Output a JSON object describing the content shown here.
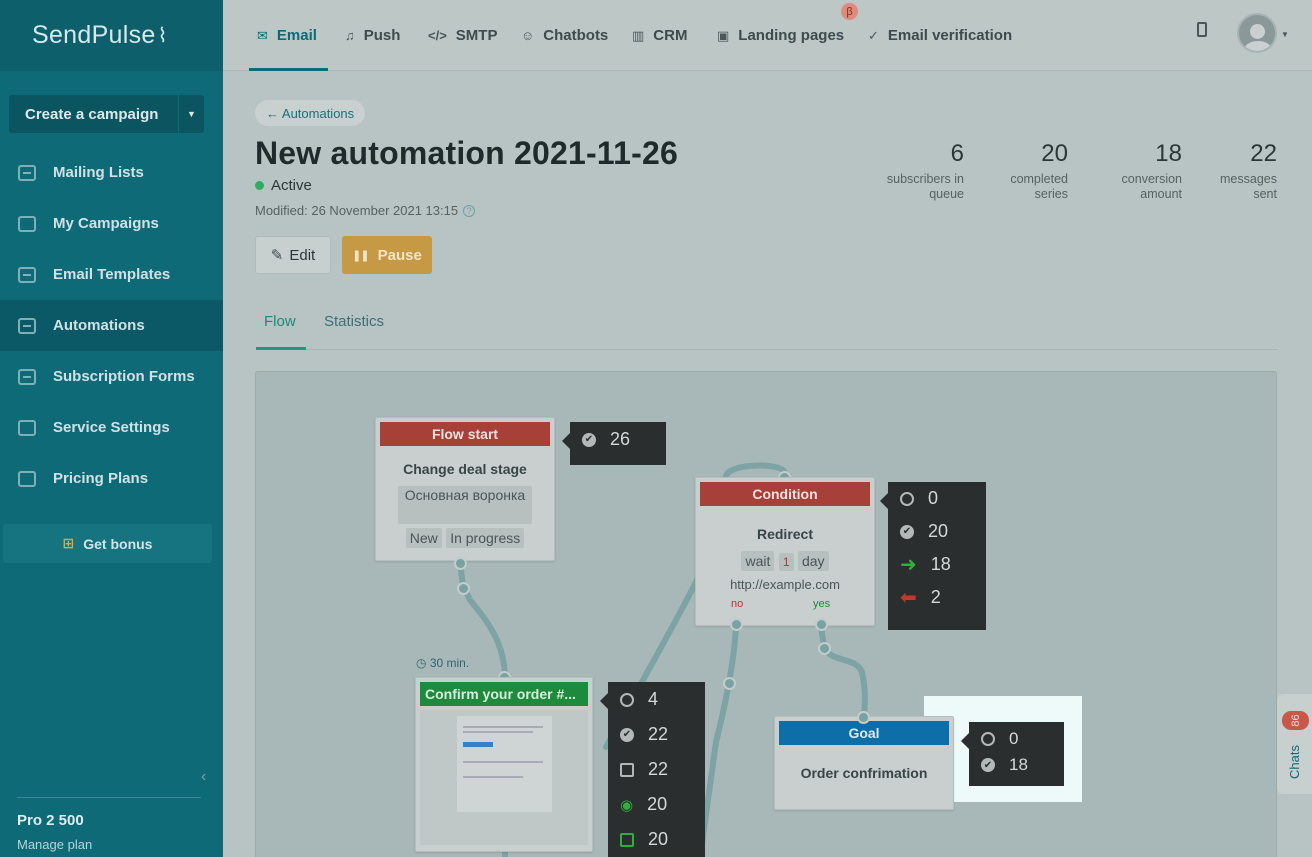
{
  "brand": {
    "name": "SendPulse",
    "pulse": "‸→"
  },
  "sidebar": {
    "create_label": "Create a campaign",
    "items": [
      {
        "label": "Mailing Lists"
      },
      {
        "label": "My Campaigns"
      },
      {
        "label": "Email Templates"
      },
      {
        "label": "Automations"
      },
      {
        "label": "Subscription Forms"
      },
      {
        "label": "Service Settings"
      },
      {
        "label": "Pricing Plans"
      }
    ],
    "bonus_label": "Get bonus",
    "plan_name": "Pro 2 500",
    "plan_link": "Manage plan"
  },
  "topnav": {
    "tabs": [
      {
        "label": "Email",
        "icon": "envelope-icon"
      },
      {
        "label": "Push",
        "icon": "bell-icon"
      },
      {
        "label": "SMTP",
        "icon": "code-icon"
      },
      {
        "label": "Chatbots",
        "icon": "chat-icon"
      },
      {
        "label": "CRM",
        "icon": "board-icon"
      },
      {
        "label": "Landing pages",
        "icon": "landing-icon"
      },
      {
        "label": "Email verification",
        "icon": "check-circle-icon"
      }
    ],
    "beta_badge": "β"
  },
  "page": {
    "breadcrumb": "← Automations",
    "title": "New automation 2021-11-26",
    "status": "Active",
    "modified": "Modified: 26 November 2021 13:15",
    "edit_label": "Edit",
    "pause_label": "Pause"
  },
  "stats": [
    {
      "value": "6",
      "label1": "subscribers in",
      "label2": "queue"
    },
    {
      "value": "20",
      "label1": "completed",
      "label2": "series"
    },
    {
      "value": "18",
      "label1": "conversion",
      "label2": "amount"
    },
    {
      "value": "22",
      "label1": "messages",
      "label2": "sent"
    }
  ],
  "flow_tabs": {
    "flow": "Flow",
    "statistics": "Statistics"
  },
  "canvas": {
    "start": {
      "header": "Flow start",
      "title": "Change deal stage",
      "chip1": "Основная воронка",
      "chip2": "New",
      "chip3": "In progress",
      "tip": "26"
    },
    "condition": {
      "header": "Condition",
      "title": "Redirect",
      "wait": "wait",
      "wait_num": "1",
      "wait_unit": "day",
      "url": "http://example.com",
      "no": "no",
      "yes": "yes",
      "tip": [
        "0",
        "20",
        "18",
        "2"
      ]
    },
    "email": {
      "delay": "30 min.",
      "header": "Confirm your order #...",
      "tip": [
        "4",
        "22",
        "22",
        "20",
        "20"
      ]
    },
    "goal": {
      "header": "Goal",
      "title": "Order confrimation",
      "tip": [
        "0",
        "18"
      ]
    }
  },
  "chats": {
    "label": "Chats",
    "count": "86"
  }
}
